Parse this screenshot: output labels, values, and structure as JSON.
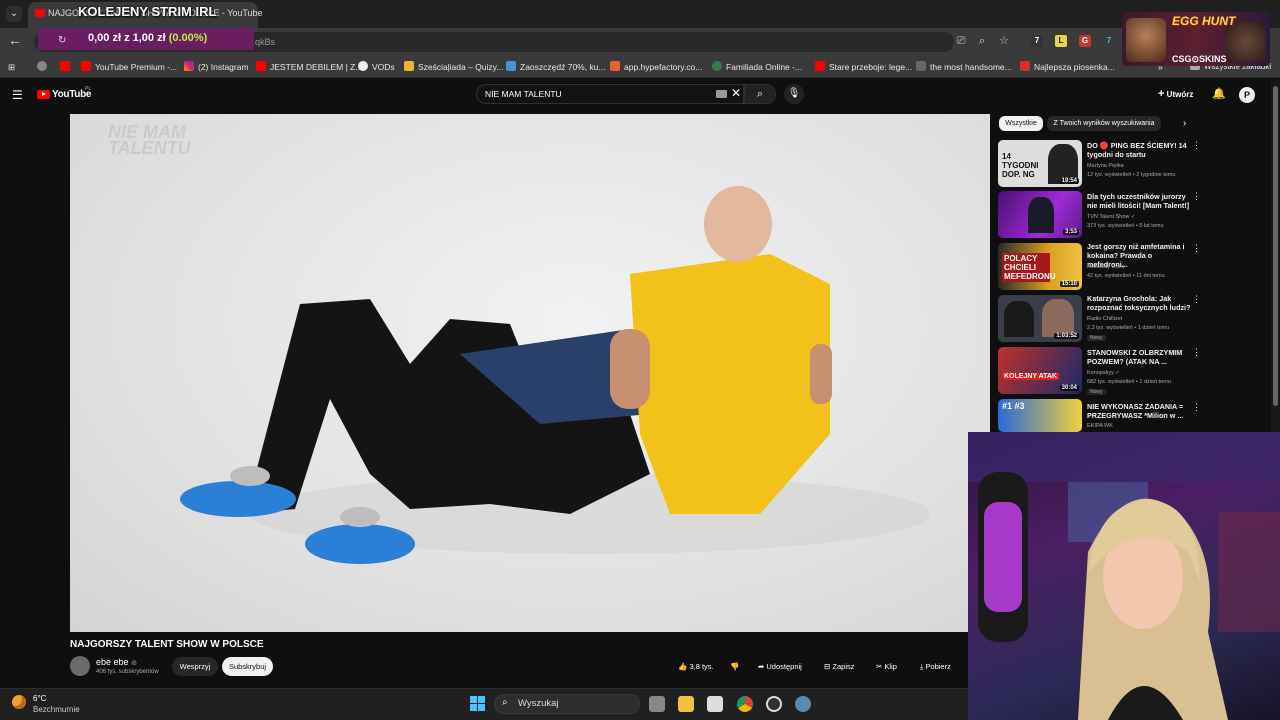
{
  "browser": {
    "tab_title": "NAJGORSZY TALENT SHOW W POLSCE - YouTube",
    "url_visible": "qkBs",
    "bookmarks": [
      {
        "label": "",
        "icon": "chrome-apps-icon"
      },
      {
        "label": "",
        "icon": "youtube-icon"
      },
      {
        "label": "YouTube Premium -...",
        "icon": "youtube-icon"
      },
      {
        "label": "(2) Instagram",
        "icon": "instagram-icon"
      },
      {
        "label": "JESTEM DEBILEM | Z...",
        "icon": "youtube-icon"
      },
      {
        "label": "VODs",
        "icon": "vods-icon"
      },
      {
        "label": "Sześciaļiada – Quizy...",
        "icon": "quiz-icon"
      },
      {
        "label": "Zaoszczędź 70%, ku...",
        "icon": "steam-icon"
      },
      {
        "label": "app.hypefactory.co...",
        "icon": "hypefactory-icon"
      },
      {
        "label": "Familiada Online -...",
        "icon": "familiada-icon"
      },
      {
        "label": "Stare przeboje: lege...",
        "icon": "youtube-icon"
      },
      {
        "label": "the most handsome...",
        "icon": "bookmark-icon"
      },
      {
        "label": "Najlepsza piosenka...",
        "icon": "u-icon"
      },
      {
        "label": "Wszystkie zakładki",
        "icon": "folder-icon"
      }
    ]
  },
  "stream_overlay": {
    "title": "KOLEJENY STRIM IRL",
    "price_main": "0,00 zł  z 1,00 zł",
    "price_pct": "(0.00%)",
    "egg_hunt": "EGG HUNT",
    "sponsor": "CSG⊙SKINS"
  },
  "youtube": {
    "logo": "YouTube",
    "logo_sup": "PL",
    "search_value": "NIE MAM TALENTU",
    "create_label": "Utwórz",
    "video": {
      "watermark_line1": "NIE MAM",
      "watermark_line2": "TALENTU",
      "title": "NAJGORSZY TALENT SHOW W POLSCE",
      "channel": "ebe ebe",
      "subs": "406 tys. subskrybentów",
      "join": "Wesprzyj",
      "subscribe": "Subskrybuj",
      "likes": "3,8 tys.",
      "share": "Udostępnij",
      "save": "Zapisz",
      "clip": "Klip",
      "download": "Pobierz"
    },
    "chips": [
      "Wszystkie",
      "Z Twoich wyników wyszukiwania"
    ],
    "related": [
      {
        "title": "DO 🔴 PING BEZ ŚCIEMY! 14 tygodni do startu",
        "channel": "Martyna Piętka",
        "meta": "12 tys. wyświetleń • 2 tygodnie temu",
        "duration": "19:54",
        "new": "",
        "thumb_text": "14 TYGODNI DOP. NG",
        "thumb_color": "#ddd"
      },
      {
        "title": "Dla tych uczestników jurorzy nie mieli litości! [Mam Talent!]",
        "channel": "TVN Talent Show ✓",
        "meta": "373 tys. wyświetleń • 5 lat temu",
        "duration": "3:53",
        "new": "",
        "thumb_text": "",
        "thumb_color": "#7a1fb0"
      },
      {
        "title": "Jest gorszy niż amfetamina i kokaina? Prawda o mefedroni...",
        "channel": "Rezultaty Extra",
        "meta": "42 tys. wyświetleń • 11 dni temu",
        "duration": "15:10",
        "new": "",
        "thumb_text": "POLACY CHCIELI MEFEDRONU",
        "thumb_color": "#d8a020"
      },
      {
        "title": "Katarzyna Grochola: Jak rozpoznać toksycznych ludzi?",
        "channel": "Radio Chillizet",
        "meta": "2,3 tys. wyświetleń • 1 dzień temu",
        "duration": "1:03:52",
        "new": "Nowy",
        "thumb_text": "",
        "thumb_color": "#3a3e48"
      },
      {
        "title": "STANOWSKI Z OLBRZYMIM POZWEM? (ATAK NA ...",
        "channel": "Konopskyy ✓",
        "meta": "682 tys. wyświetleń • 1 dzień temu",
        "duration": "30:04",
        "new": "Nowy",
        "thumb_text": "KOLEJNY ATAK",
        "thumb_color": "#c0302a"
      },
      {
        "title": "NIE WYKONASZ ZADANIA = PRZEGRYWASZ *Milion w ...",
        "channel": "EKIPA WK",
        "meta": "",
        "duration": "",
        "new": "",
        "thumb_text": "#1 #3",
        "thumb_color": "#2a6ad8"
      }
    ]
  },
  "taskbar": {
    "temp": "6°C",
    "weather": "Bezchmurnie",
    "search": "Wyszukaj",
    "apps": [
      "task-view-icon",
      "file-explorer-icon",
      "store-icon",
      "chrome-icon",
      "obs-icon",
      "settings-icon"
    ]
  }
}
